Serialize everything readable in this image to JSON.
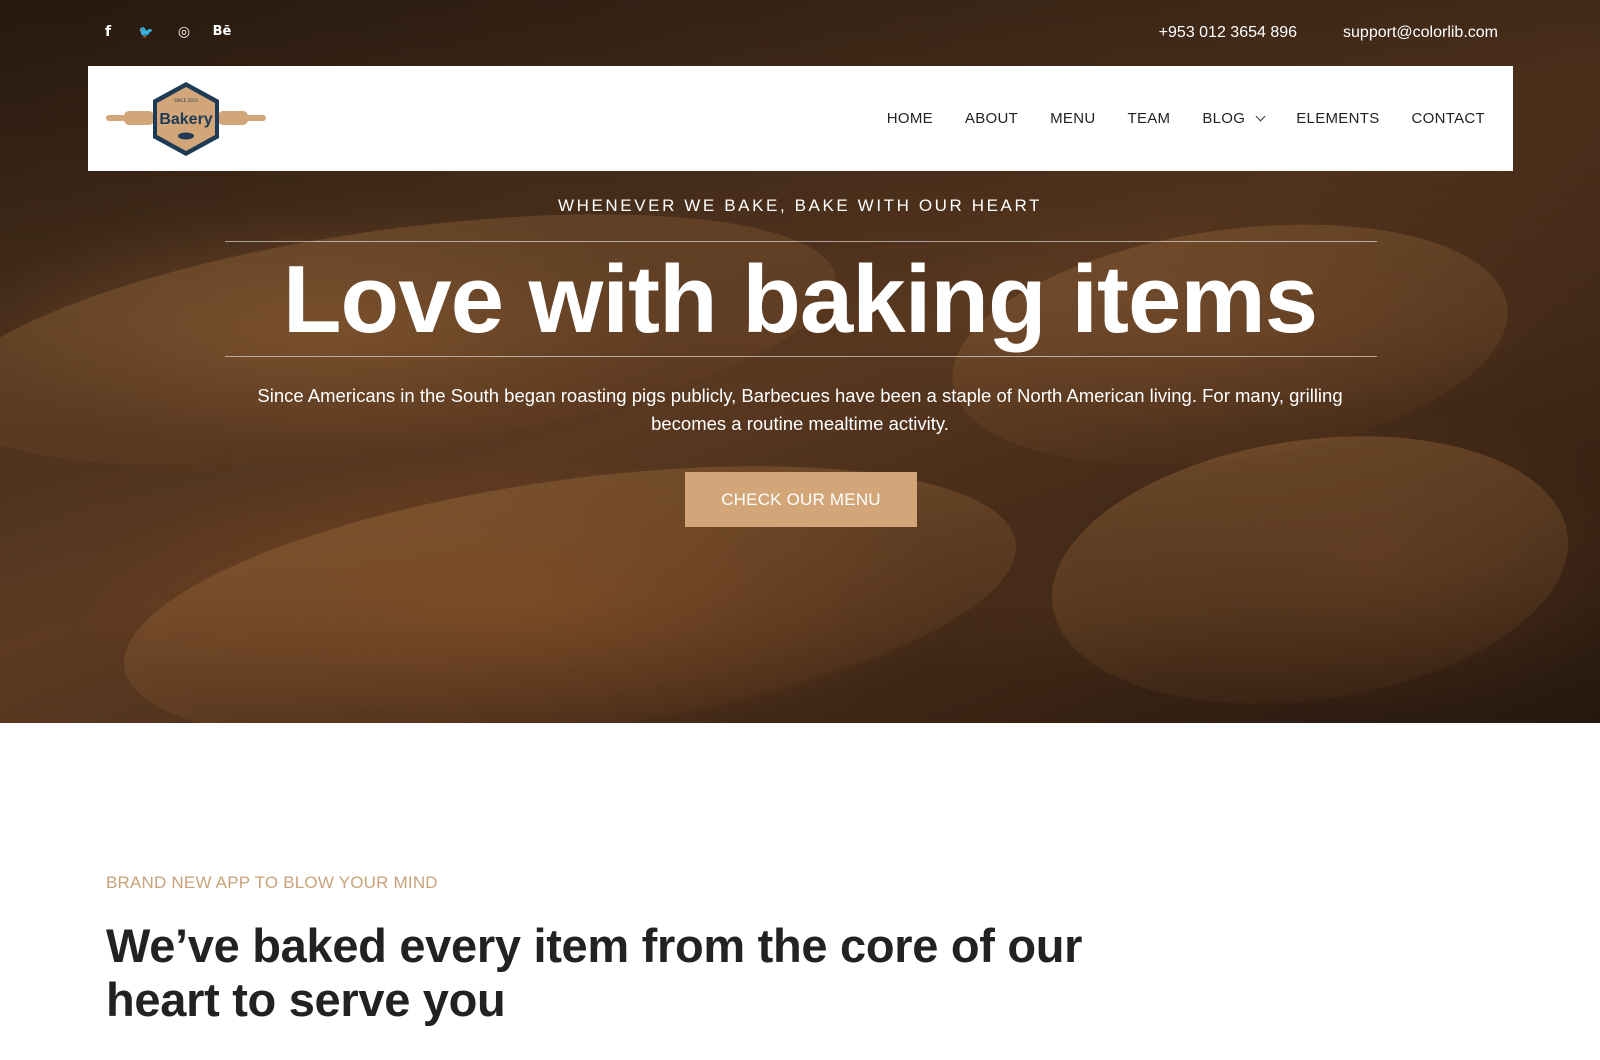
{
  "topbar": {
    "social": [
      {
        "icon": "facebook-icon",
        "glyph": "f"
      },
      {
        "icon": "twitter-icon",
        "glyph": "🐦"
      },
      {
        "icon": "dribbble-icon",
        "glyph": "◎"
      },
      {
        "icon": "behance-icon",
        "glyph": "Bē"
      }
    ],
    "phone": "+953 012 3654 896",
    "email": "support@colorlib.com"
  },
  "brand": {
    "logo_text": "Bakery",
    "logo_small": "SINCE 2010",
    "accent": "#d2a679",
    "logo_dark": "#1f3a55"
  },
  "nav": {
    "items": [
      {
        "label": "HOME"
      },
      {
        "label": "ABOUT"
      },
      {
        "label": "MENU"
      },
      {
        "label": "TEAM"
      },
      {
        "label": "BLOG",
        "dropdown": true
      },
      {
        "label": "ELEMENTS"
      },
      {
        "label": "CONTACT"
      }
    ]
  },
  "hero": {
    "tagline": "WHENEVER WE BAKE, BAKE WITH OUR HEART",
    "title": "Love with baking items",
    "description": "Since Americans in the South began roasting pigs publicly, Barbecues have been a staple of North American living. For many, grilling becomes a routine mealtime activity.",
    "button_label": "CHECK OUR MENU"
  },
  "about": {
    "eyebrow": "BRAND NEW APP TO BLOW YOUR MIND",
    "heading": "We’ve baked every item from the core of our heart to serve you"
  }
}
